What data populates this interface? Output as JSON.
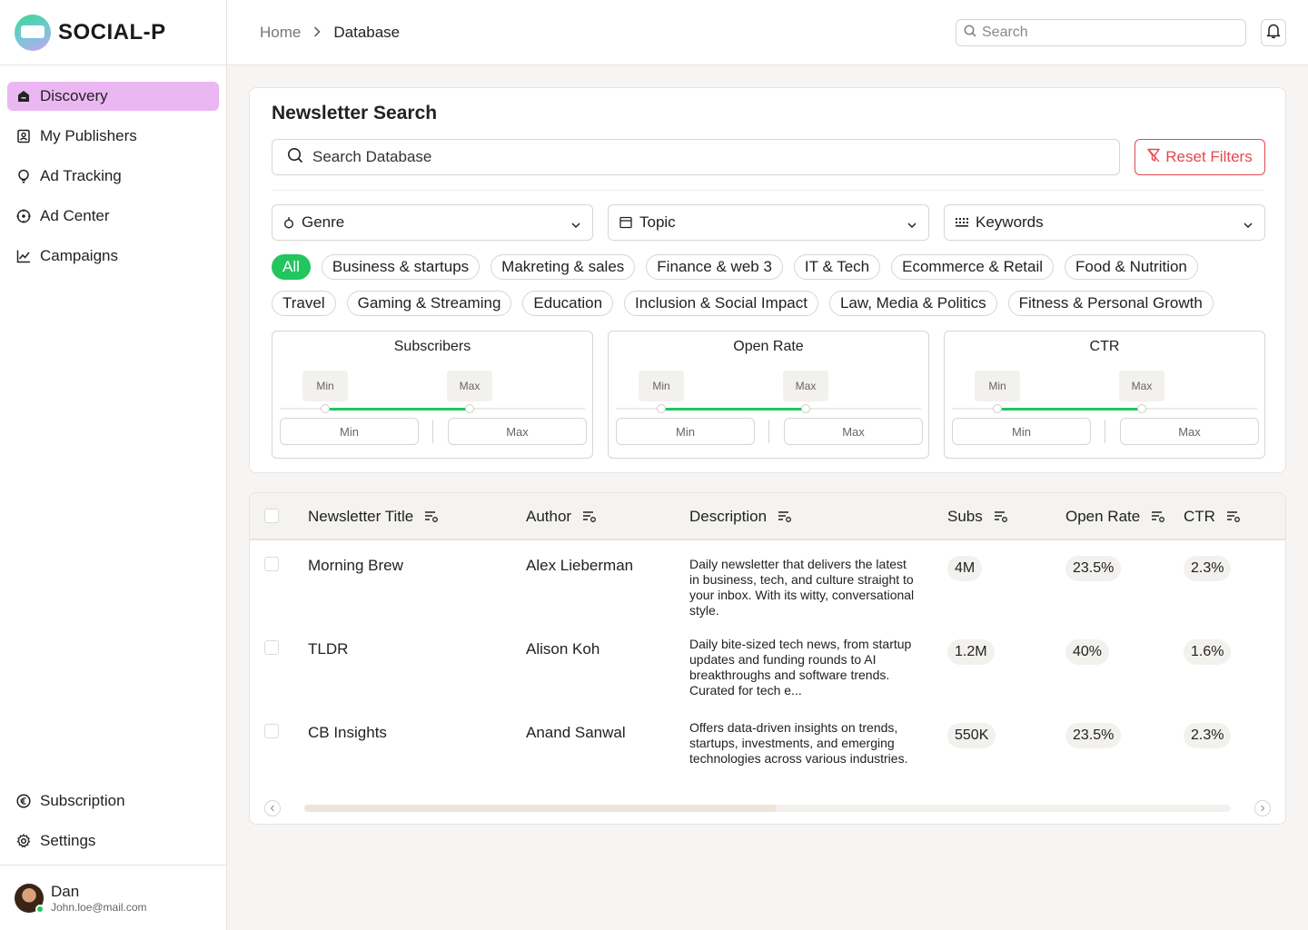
{
  "app": {
    "name": "SOCIAL-P"
  },
  "sidebar": {
    "items": [
      {
        "label": "Discovery",
        "icon": "home-icon",
        "active": true
      },
      {
        "label": "My Publishers",
        "icon": "contact-book-icon"
      },
      {
        "label": "Ad Tracking",
        "icon": "lightbulb-icon"
      },
      {
        "label": "Ad Center",
        "icon": "target-icon"
      },
      {
        "label": "Campaigns",
        "icon": "line-chart-icon"
      }
    ],
    "bottom_items": [
      {
        "label": "Subscription",
        "icon": "euro-icon"
      },
      {
        "label": "Settings",
        "icon": "gear-icon"
      }
    ],
    "user": {
      "name": "Dan",
      "email": "John.loe@mail.com"
    }
  },
  "topbar": {
    "breadcrumb": {
      "home": "Home",
      "current": "Database"
    },
    "search_placeholder": "Search"
  },
  "filters": {
    "title": "Newsletter Search",
    "search_placeholder": "Search Database",
    "reset_label": "Reset Filters",
    "dropdowns": {
      "genre": "Genre",
      "topic": "Topic",
      "keywords": "Keywords"
    },
    "chips_row1": [
      "All",
      "Business & startups",
      "Makreting & sales",
      "Finance & web 3",
      "IT & Tech",
      "Ecommerce & Retail",
      "Food & Nutrition"
    ],
    "chips_row2": [
      "Travel",
      "Gaming & Streaming",
      "Education",
      "Inclusion & Social Impact",
      "Law, Media & Politics",
      "Fitness & Personal Growth"
    ],
    "active_chip": "All",
    "ranges": [
      {
        "title": "Subscribers",
        "min_tag": "Min",
        "max_tag": "Max",
        "min_placeholder": "Min",
        "max_placeholder": "Max"
      },
      {
        "title": "Open Rate",
        "min_tag": "Min",
        "max_tag": "Max",
        "min_placeholder": "Min",
        "max_placeholder": "Max"
      },
      {
        "title": "CTR",
        "min_tag": "Min",
        "max_tag": "Max",
        "min_placeholder": "Min",
        "max_placeholder": "Max"
      }
    ]
  },
  "table": {
    "columns": {
      "title": "Newsletter Title",
      "author": "Author",
      "description": "Description",
      "subs": "Subs",
      "open_rate": "Open Rate",
      "ctr": "CTR"
    },
    "rows": [
      {
        "title": "Morning Brew",
        "author": "Alex Lieberman",
        "description": "Daily newsletter that delivers the latest in business, tech, and culture straight to your inbox. With its witty, conversational style.",
        "subs": "4M",
        "open_rate": "23.5%",
        "ctr": "2.3%"
      },
      {
        "title": "TLDR",
        "author": "Alison Koh",
        "description": "Daily bite-sized tech news, from startup updates and funding rounds to AI breakthroughs and software trends. Curated for tech e...",
        "subs": "1.2M",
        "open_rate": "40%",
        "ctr": "1.6%"
      },
      {
        "title": "CB Insights",
        "author": "Anand Sanwal",
        "description": "Offers data-driven insights on trends, startups, investments, and emerging technologies across various industries.",
        "subs": "550K",
        "open_rate": "23.5%",
        "ctr": "2.3%"
      }
    ]
  },
  "colors": {
    "accent": "#22c55e",
    "nav_active": "#ebb7f3",
    "danger": "#e5484d"
  }
}
